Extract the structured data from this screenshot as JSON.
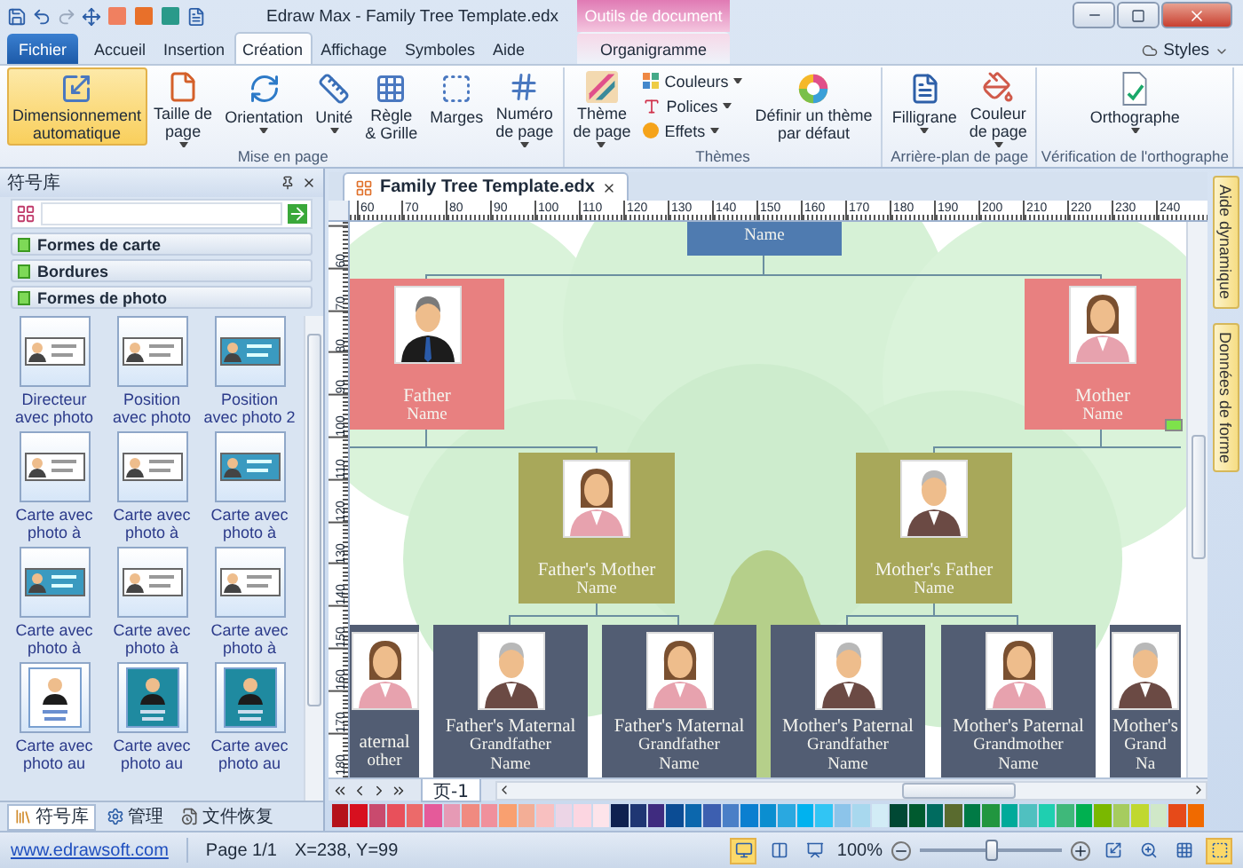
{
  "window": {
    "title": "Edraw Max - Family Tree Template.edx"
  },
  "ribbon_tabs": {
    "file": "Fichier",
    "tabs": [
      {
        "label": "Accueil",
        "selected": false
      },
      {
        "label": "Insertion",
        "selected": false
      },
      {
        "label": "Création",
        "selected": true
      },
      {
        "label": "Affichage",
        "selected": false
      },
      {
        "label": "Symboles",
        "selected": false
      },
      {
        "label": "Aide",
        "selected": false
      }
    ],
    "contextual": {
      "title": "Outils de document",
      "tabs": [
        {
          "label": "Organigramme",
          "selected": false
        }
      ]
    },
    "styles": "Styles"
  },
  "ribbon_groups": [
    {
      "title": "Mise en page",
      "buttons": [
        {
          "kind": "large",
          "label": "Dimensionnement\nautomatique",
          "dropdown": false,
          "active": true
        },
        {
          "kind": "large",
          "label": "Taille de\npage",
          "dropdown": true,
          "active": false
        },
        {
          "kind": "large",
          "label": "Orientation",
          "dropdown": true,
          "active": false
        },
        {
          "kind": "large",
          "label": "Unité",
          "dropdown": true,
          "active": false
        },
        {
          "kind": "large",
          "label": "Règle\n& Grille",
          "dropdown": false,
          "active": false
        },
        {
          "kind": "large",
          "label": "Marges",
          "dropdown": false,
          "active": false
        },
        {
          "kind": "large",
          "label": "Numéro\nde page",
          "dropdown": true,
          "active": false
        }
      ]
    },
    {
      "title": "Thèmes",
      "buttons": [
        {
          "kind": "large",
          "label": "Thème\nde page",
          "dropdown": true,
          "active": false
        },
        {
          "kind": "small",
          "label": "Couleurs",
          "dropdown": true,
          "active": false
        },
        {
          "kind": "small",
          "label": "Polices",
          "dropdown": true,
          "active": false
        },
        {
          "kind": "small",
          "label": "Effets",
          "dropdown": true,
          "active": false
        },
        {
          "kind": "large",
          "label": "Définir un thème\npar défaut",
          "dropdown": false,
          "active": false
        }
      ]
    },
    {
      "title": "Arrière-plan de page",
      "buttons": [
        {
          "kind": "large",
          "label": "Filligrane",
          "dropdown": true,
          "active": false
        },
        {
          "kind": "large",
          "label": "Couleur\nde page",
          "dropdown": true,
          "active": false
        }
      ]
    },
    {
      "title": "Vérification de l'orthographe",
      "buttons": [
        {
          "kind": "large",
          "label": "Orthographe",
          "dropdown": true,
          "active": false
        }
      ]
    }
  ],
  "symbol_panel": {
    "title": "符号库",
    "categories": [
      {
        "label": "Formes de carte"
      },
      {
        "label": "Bordures"
      },
      {
        "label": "Formes de photo"
      }
    ],
    "shapes": [
      {
        "label": "Directeur avec photo",
        "kind": "landscape"
      },
      {
        "label": "Position avec photo",
        "kind": "landscape"
      },
      {
        "label": "Position avec photo 2",
        "kind": "banner"
      },
      {
        "label": "Carte avec photo à",
        "kind": "landscape"
      },
      {
        "label": "Carte avec photo à",
        "kind": "landscape"
      },
      {
        "label": "Carte avec photo à",
        "kind": "banner"
      },
      {
        "label": "Carte avec photo à",
        "kind": "banner"
      },
      {
        "label": "Carte avec photo à",
        "kind": "landscape"
      },
      {
        "label": "Carte avec photo à",
        "kind": "landscape"
      },
      {
        "label": "Carte avec photo au",
        "kind": "portrait"
      },
      {
        "label": "Carte avec photo au",
        "kind": "portrait-dark"
      },
      {
        "label": "Carte avec photo au",
        "kind": "portrait-dark"
      }
    ],
    "bottom_tabs": [
      {
        "label": "符号库",
        "selected": true
      },
      {
        "label": "管理",
        "selected": false
      },
      {
        "label": "文件恢复",
        "selected": false
      }
    ]
  },
  "document_tab": {
    "title": "Family Tree Template.edx"
  },
  "ruler": {
    "horizontal": [
      "60",
      "70",
      "80",
      "90",
      "100",
      "110",
      "120",
      "130",
      "140",
      "150",
      "160",
      "170",
      "180",
      "190",
      "200",
      "210",
      "220",
      "230",
      "240"
    ],
    "vertical": [
      "60",
      "70",
      "80",
      "90",
      "100",
      "110",
      "120",
      "130",
      "140",
      "150",
      "160",
      "170",
      "180"
    ]
  },
  "diagram": {
    "nodes": [
      {
        "lines": [
          "Name"
        ],
        "color": "#4f7bb0",
        "kind": "plain"
      },
      {
        "lines": [
          "Father",
          "Name"
        ],
        "color": "#e88080",
        "kind": "man"
      },
      {
        "lines": [
          "Mother",
          "Name"
        ],
        "color": "#e88080",
        "kind": "woman"
      },
      {
        "lines": [
          "Father's Mother",
          "Name"
        ],
        "color": "#a8a85a",
        "kind": "woman"
      },
      {
        "lines": [
          "Mother's Father",
          "Name"
        ],
        "color": "#a8a85a",
        "kind": "elder"
      },
      {
        "lines": [
          "aternal",
          "other"
        ],
        "color": "#525d73",
        "kind": "woman"
      },
      {
        "lines": [
          "Father's Maternal",
          "Grandfather",
          "Name"
        ],
        "color": "#525d73",
        "kind": "elder"
      },
      {
        "lines": [
          "Father's Maternal",
          "Grandfather",
          "Name"
        ],
        "color": "#525d73",
        "kind": "woman"
      },
      {
        "lines": [
          "Mother's Paternal",
          "Grandfather",
          "Name"
        ],
        "color": "#525d73",
        "kind": "elder"
      },
      {
        "lines": [
          "Mother's Paternal",
          "Grandmother",
          "Name"
        ],
        "color": "#525d73",
        "kind": "woman"
      },
      {
        "lines": [
          "Mother's",
          "Grand",
          "Na"
        ],
        "color": "#525d73",
        "kind": "elder"
      }
    ]
  },
  "page_tabs": [
    {
      "label": "页-1",
      "selected": true
    }
  ],
  "palette": [
    {
      "color": "#b5121b"
    },
    {
      "color": "#d7101f"
    },
    {
      "color": "#c94a6e"
    },
    {
      "color": "#e8505b"
    },
    {
      "color": "#ec6a6a"
    },
    {
      "color": "#e55a9a"
    },
    {
      "color": "#e69ab5"
    },
    {
      "color": "#f08a80"
    },
    {
      "color": "#f0909c"
    },
    {
      "color": "#f9a070"
    },
    {
      "color": "#f3ae96"
    },
    {
      "color": "#f8c0c0"
    },
    {
      "color": "#ecd5e6"
    },
    {
      "color": "#fcd6e1"
    },
    {
      "color": "#fde4ea"
    },
    {
      "color": "#0f2150"
    },
    {
      "color": "#1f3673"
    },
    {
      "color": "#3f2b7f"
    },
    {
      "color": "#0b4c94"
    },
    {
      "color": "#0c67ad"
    },
    {
      "color": "#3d5fb0"
    },
    {
      "color": "#4a7fc7"
    },
    {
      "color": "#0b7fd0"
    },
    {
      "color": "#0b8ed0"
    },
    {
      "color": "#2aa8e0"
    },
    {
      "color": "#00b2ef"
    },
    {
      "color": "#31c5f4"
    },
    {
      "color": "#8cc4ea"
    },
    {
      "color": "#a8d8ee"
    },
    {
      "color": "#d2ecf6"
    },
    {
      "color": "#004834"
    },
    {
      "color": "#005a2f"
    },
    {
      "color": "#006b5f"
    },
    {
      "color": "#5a6b2f"
    },
    {
      "color": "#007a45"
    },
    {
      "color": "#21963f"
    },
    {
      "color": "#00aa9a"
    },
    {
      "color": "#50c0c0"
    },
    {
      "color": "#1fcfb0"
    },
    {
      "color": "#3fb87a"
    },
    {
      "color": "#00b050"
    },
    {
      "color": "#7ab800"
    },
    {
      "color": "#a6cc5f"
    },
    {
      "color": "#c0d830"
    },
    {
      "color": "#d0e8c8"
    },
    {
      "color": "#e64a19"
    },
    {
      "color": "#f06a00"
    }
  ],
  "side_tabs": [
    "Aide dynamique",
    "Données de forme"
  ],
  "status_bar": {
    "link": "www.edrawsoft.com",
    "page": "Page 1/1",
    "coords": "X=238, Y=99",
    "zoom": "100%",
    "zoom_slider": {
      "level": 0.5
    }
  }
}
